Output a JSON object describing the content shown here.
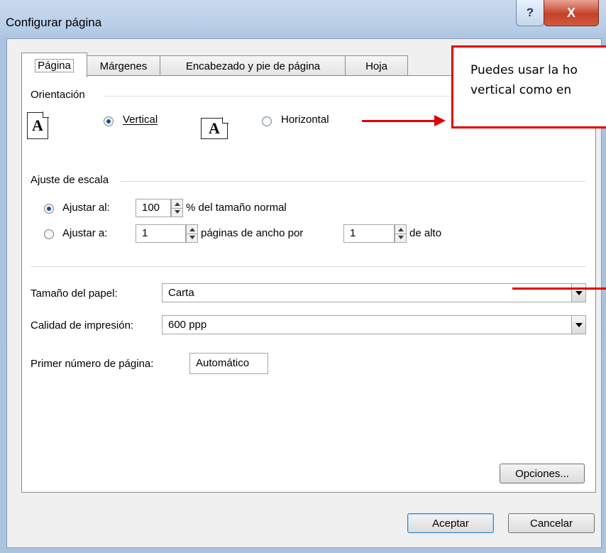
{
  "window": {
    "title": "Configurar página",
    "help_label": "?",
    "close_label": "X"
  },
  "tabs": [
    {
      "label": "Página",
      "active": true
    },
    {
      "label": "Márgenes",
      "active": false
    },
    {
      "label": "Encabezado y pie de página",
      "active": false
    },
    {
      "label": "Hoja",
      "active": false
    }
  ],
  "orientation": {
    "group_label": "Orientación",
    "icon_letter": "A",
    "vertical_label": "Vertical",
    "horizontal_label": "Horizontal",
    "selected": "vertical"
  },
  "scaling": {
    "group_label": "Ajuste de escala",
    "adjust_to_label": "Ajustar al:",
    "adjust_to_value": "100",
    "adjust_to_suffix": "% del tamaño normal",
    "fit_to_label": "Ajustar a:",
    "fit_width_value": "1",
    "fit_width_suffix": "páginas de ancho por",
    "fit_height_value": "1",
    "fit_height_suffix": "de alto",
    "selected": "adjust_to"
  },
  "paper": {
    "size_label": "Tamaño del papel:",
    "size_value": "Carta",
    "quality_label": "Calidad de impresión:",
    "quality_value": "600 ppp",
    "first_page_label": "Primer número de página:",
    "first_page_value": "Automático"
  },
  "buttons": {
    "options": "Opciones...",
    "ok": "Aceptar",
    "cancel": "Cancelar"
  },
  "callout": {
    "text": "Puedes usar la ho\nvertical como en",
    "color": "#e00000"
  }
}
